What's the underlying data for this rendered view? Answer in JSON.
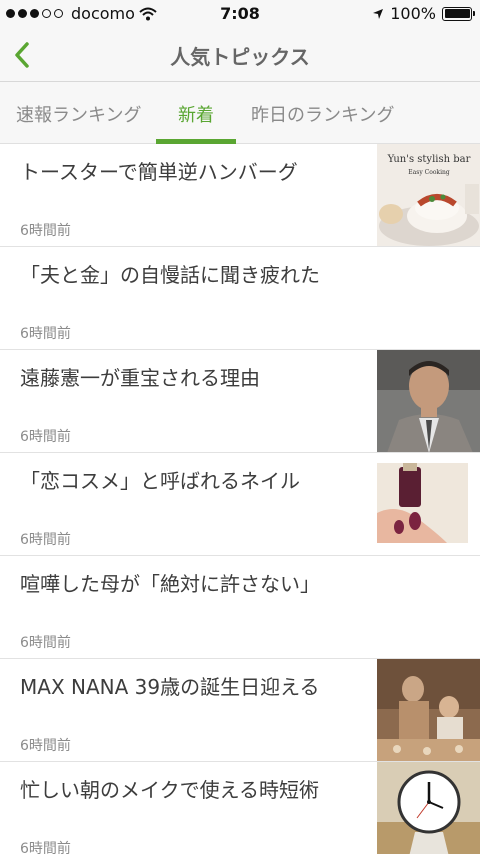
{
  "status_bar": {
    "carrier": "docomo",
    "time": "7:08",
    "battery": "100%",
    "signal_bars": 3
  },
  "nav": {
    "title": "人気トピックス",
    "back_icon": "chevron-left-icon",
    "accent_color": "#5aa632"
  },
  "tabs": [
    {
      "label": "速報ランキング",
      "active": false
    },
    {
      "label": "新着",
      "active": true
    },
    {
      "label": "昨日のランキング",
      "active": false
    }
  ],
  "articles": [
    {
      "title": "トースターで簡単逆ハンバーグ",
      "time": "6時間前",
      "thumb_text_1": "Yun's stylish bar",
      "thumb_text_2": "Easy Cooking"
    },
    {
      "title": "「夫と金」の自慢話に聞き疲れた",
      "time": "6時間前"
    },
    {
      "title": "遠藤憲一が重宝される理由",
      "time": "6時間前"
    },
    {
      "title": "「恋コスメ」と呼ばれるネイル",
      "time": "6時間前"
    },
    {
      "title": "喧嘩した母が「絶対に許さない」",
      "time": "6時間前"
    },
    {
      "title": "MAX NANA 39歳の誕生日迎える",
      "time": "6時間前"
    },
    {
      "title": "忙しい朝のメイクで使える時短術",
      "time": "6時間前"
    }
  ]
}
